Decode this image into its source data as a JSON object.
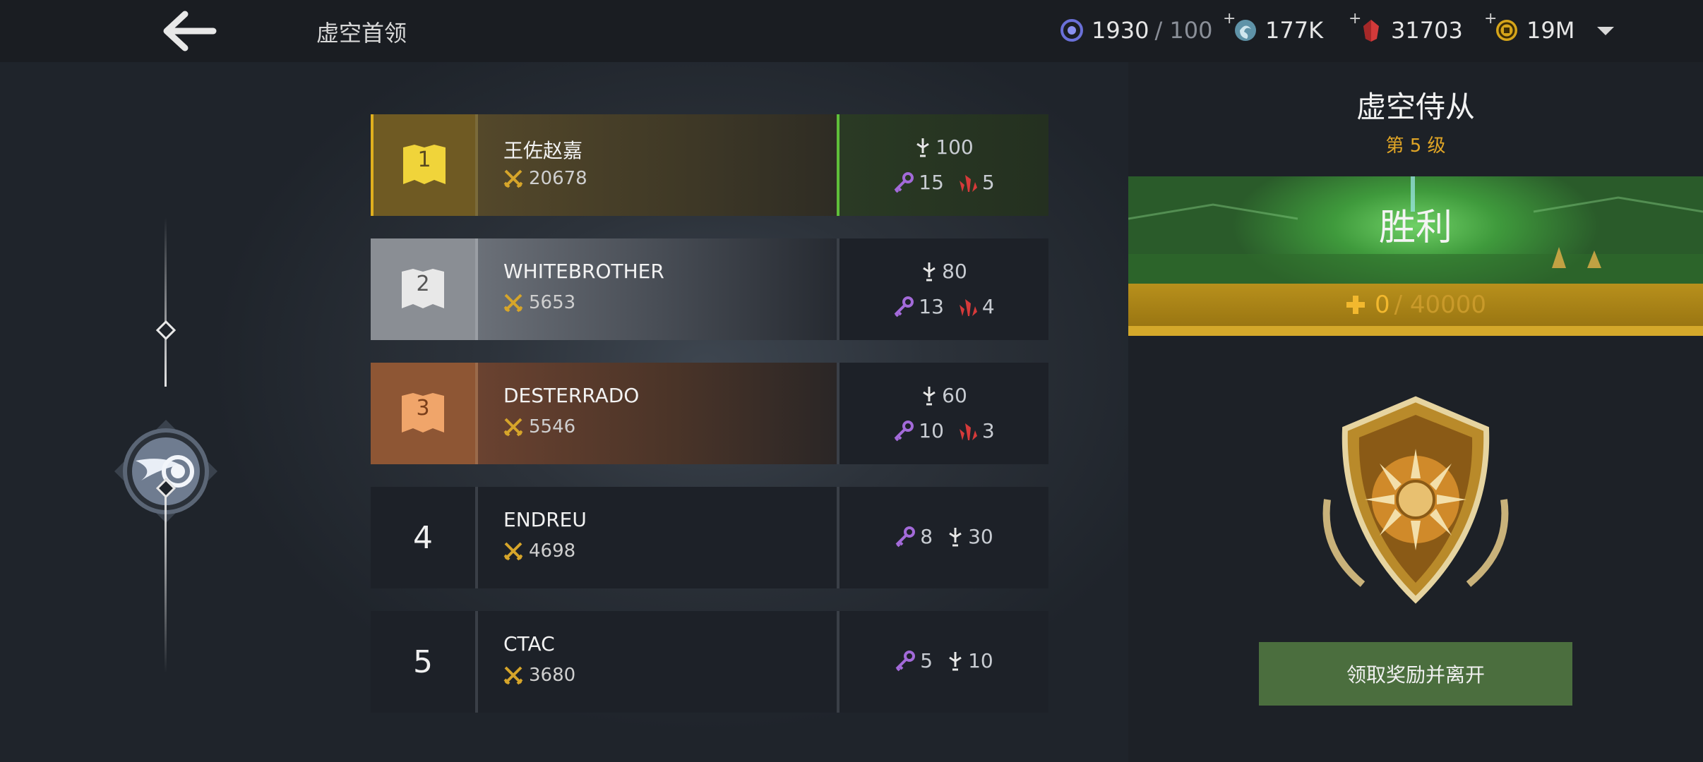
{
  "header": {
    "title": "虚空首领",
    "resources": [
      {
        "icon": "void-energy-icon",
        "value": "1930",
        "max": "/ 100",
        "plus": false
      },
      {
        "icon": "swirl-orb-icon",
        "value": "177K",
        "plus": true
      },
      {
        "icon": "red-gem-icon",
        "value": "31703",
        "plus": true
      },
      {
        "icon": "gold-coin-icon",
        "value": "19M",
        "plus": true
      }
    ]
  },
  "leaderboard": [
    {
      "rank": "1",
      "name": "王佐赵嘉",
      "power": "20678",
      "rewards": {
        "line1": [
          {
            "icon": "sword-icon",
            "value": "100"
          }
        ],
        "line2": [
          {
            "icon": "key-icon",
            "value": "15"
          },
          {
            "icon": "crystal-icon",
            "value": "5"
          }
        ]
      }
    },
    {
      "rank": "2",
      "name": "WHITEBROTHER",
      "power": "5653",
      "rewards": {
        "line1": [
          {
            "icon": "sword-icon",
            "value": "80"
          }
        ],
        "line2": [
          {
            "icon": "key-icon",
            "value": "13"
          },
          {
            "icon": "crystal-icon",
            "value": "4"
          }
        ]
      }
    },
    {
      "rank": "3",
      "name": "DESTERRADO",
      "power": "5546",
      "rewards": {
        "line1": [
          {
            "icon": "sword-icon",
            "value": "60"
          }
        ],
        "line2": [
          {
            "icon": "key-icon",
            "value": "10"
          },
          {
            "icon": "crystal-icon",
            "value": "3"
          }
        ]
      }
    },
    {
      "rank": "4",
      "name": "ENDREU",
      "power": "4698",
      "rewards": {
        "line1": [
          {
            "icon": "key-icon",
            "value": "8"
          },
          {
            "icon": "sword-icon",
            "value": "30"
          }
        ]
      }
    },
    {
      "rank": "5",
      "name": "CTAC",
      "power": "3680",
      "rewards": {
        "line1": [
          {
            "icon": "key-icon",
            "value": "5"
          },
          {
            "icon": "sword-icon",
            "value": "10"
          }
        ]
      }
    }
  ],
  "panel": {
    "title": "虚空侍从",
    "level": "第 5 级",
    "result": "胜利",
    "progress_current": "0",
    "progress_max": "/ 40000",
    "claim_label": "领取奖励并离开"
  },
  "colors": {
    "gold": "#e0a526",
    "accent_green": "#4b6e3e",
    "key": "#a36ad9",
    "crystal": "#d63a3a"
  }
}
